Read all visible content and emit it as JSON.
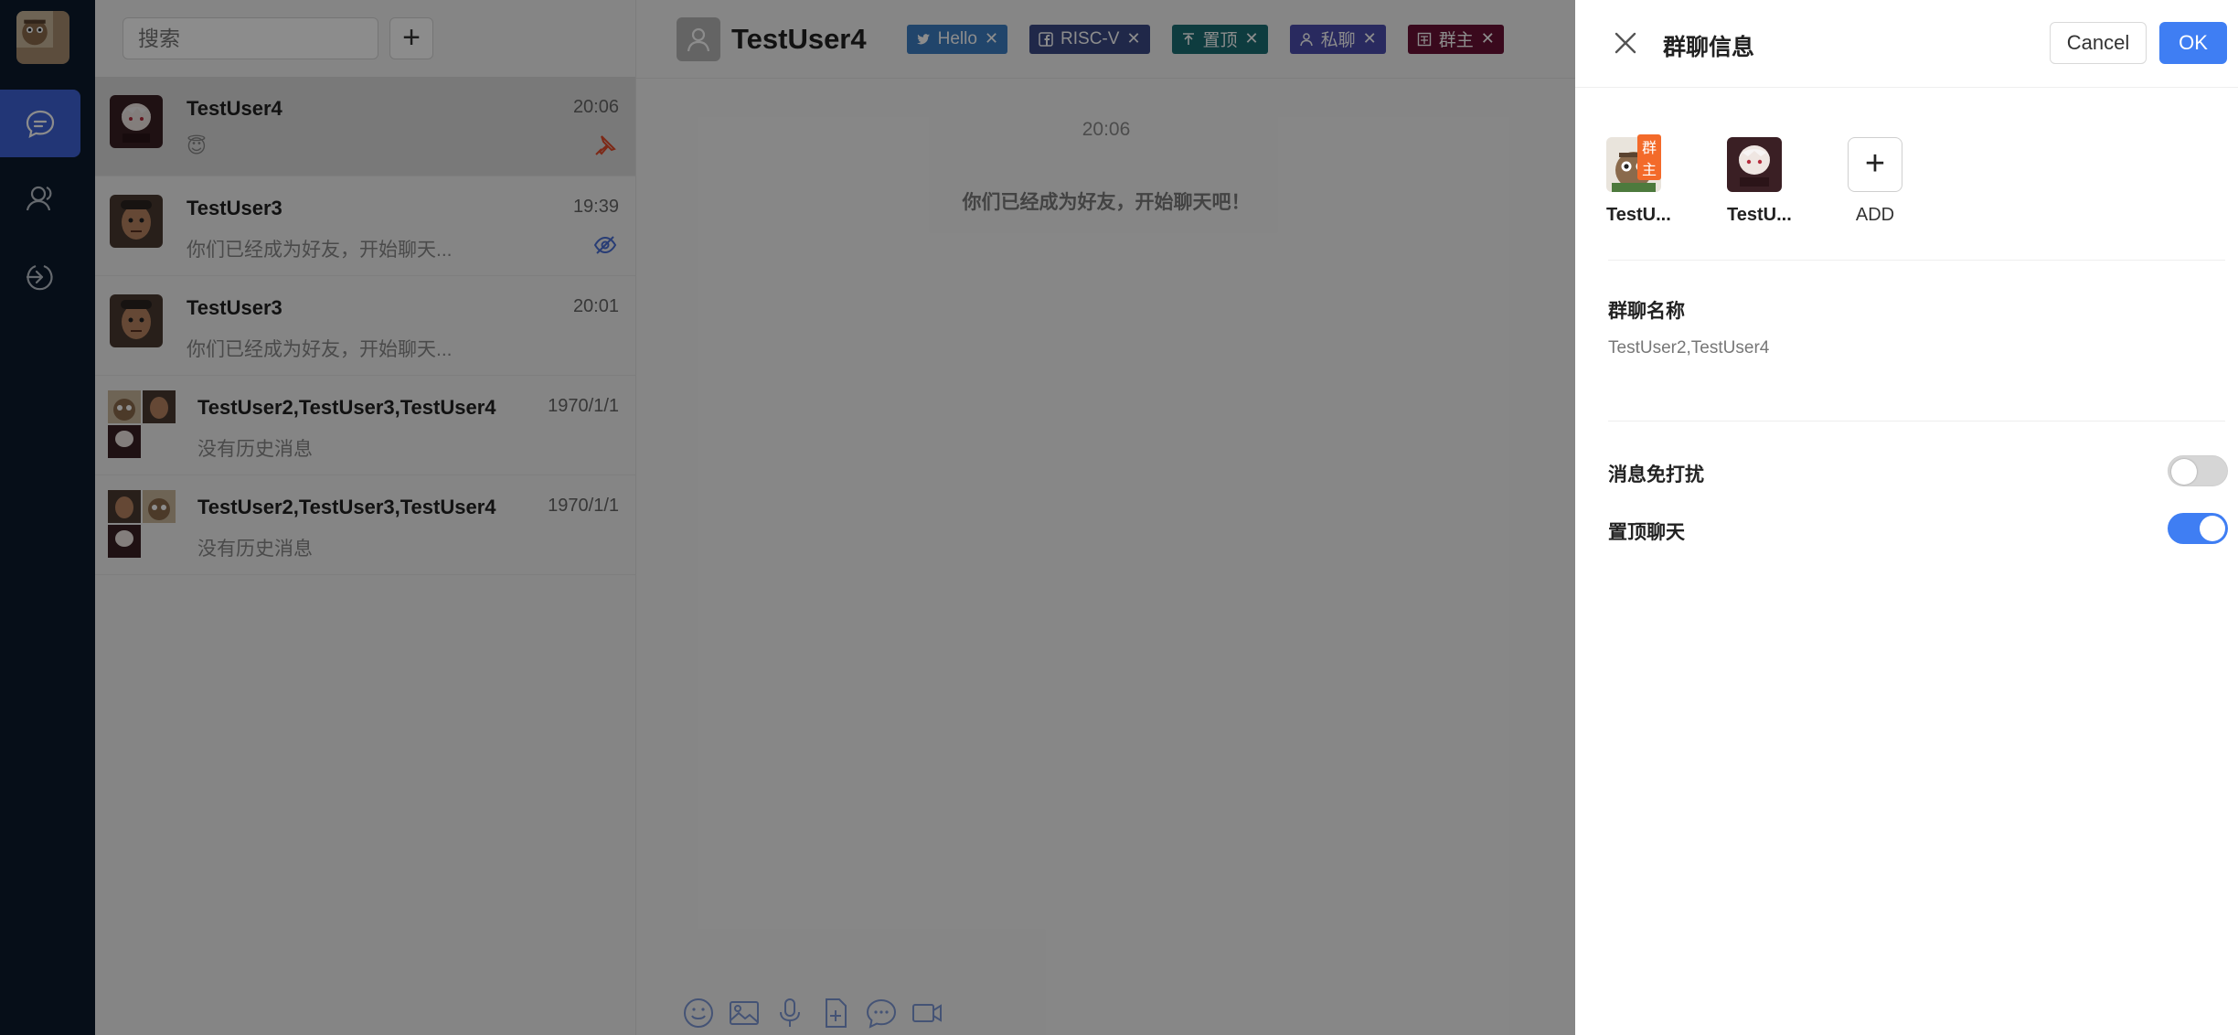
{
  "search": {
    "placeholder": "搜索",
    "add_label": "+"
  },
  "conversations": [
    {
      "name": "TestUser4",
      "time": "20:06",
      "preview": "😇"
    },
    {
      "name": "TestUser3",
      "time": "19:39",
      "preview": "你们已经成为好友，开始聊天..."
    },
    {
      "name": "TestUser3",
      "time": "20:01",
      "preview": "你们已经成为好友，开始聊天..."
    },
    {
      "name": "TestUser2,TestUser3,TestUser4",
      "time": "1970/1/1",
      "preview": "没有历史消息"
    },
    {
      "name": "TestUser2,TestUser3,TestUser4",
      "time": "1970/1/1",
      "preview": "没有历史消息"
    }
  ],
  "chat": {
    "title": "TestUser4",
    "tags": [
      {
        "label": "Hello",
        "icon": "twitter-icon",
        "color": "#3d7fc4"
      },
      {
        "label": "RISC-V",
        "icon": "facebook-icon",
        "color": "#3b4a86"
      },
      {
        "label": "置顶",
        "icon": "pin-icon",
        "color": "#1b6e74"
      },
      {
        "label": "私聊",
        "icon": "user-icon",
        "color": "#4b4dae"
      },
      {
        "label": "群主",
        "icon": "group-icon",
        "color": "#6b1236"
      }
    ],
    "timestamp": "20:06",
    "system_message": "你们已经成为好友，开始聊天吧！"
  },
  "drawer": {
    "title": "群聊信息",
    "cancel_label": "Cancel",
    "ok_label": "OK",
    "members": [
      {
        "name": "TestU...",
        "badge": "群主"
      },
      {
        "name": "TestU..."
      }
    ],
    "add_label": "ADD",
    "group_name_label": "群聊名称",
    "group_name_value": "TestUser2,TestUser4",
    "mute_label": "消息免打扰",
    "mute_on": false,
    "pin_label": "置顶聊天",
    "pin_on": true
  },
  "colors": {
    "accent": "#3f7ef3",
    "rail": "#0c1b2c",
    "owner_badge": "#f36a2a"
  }
}
